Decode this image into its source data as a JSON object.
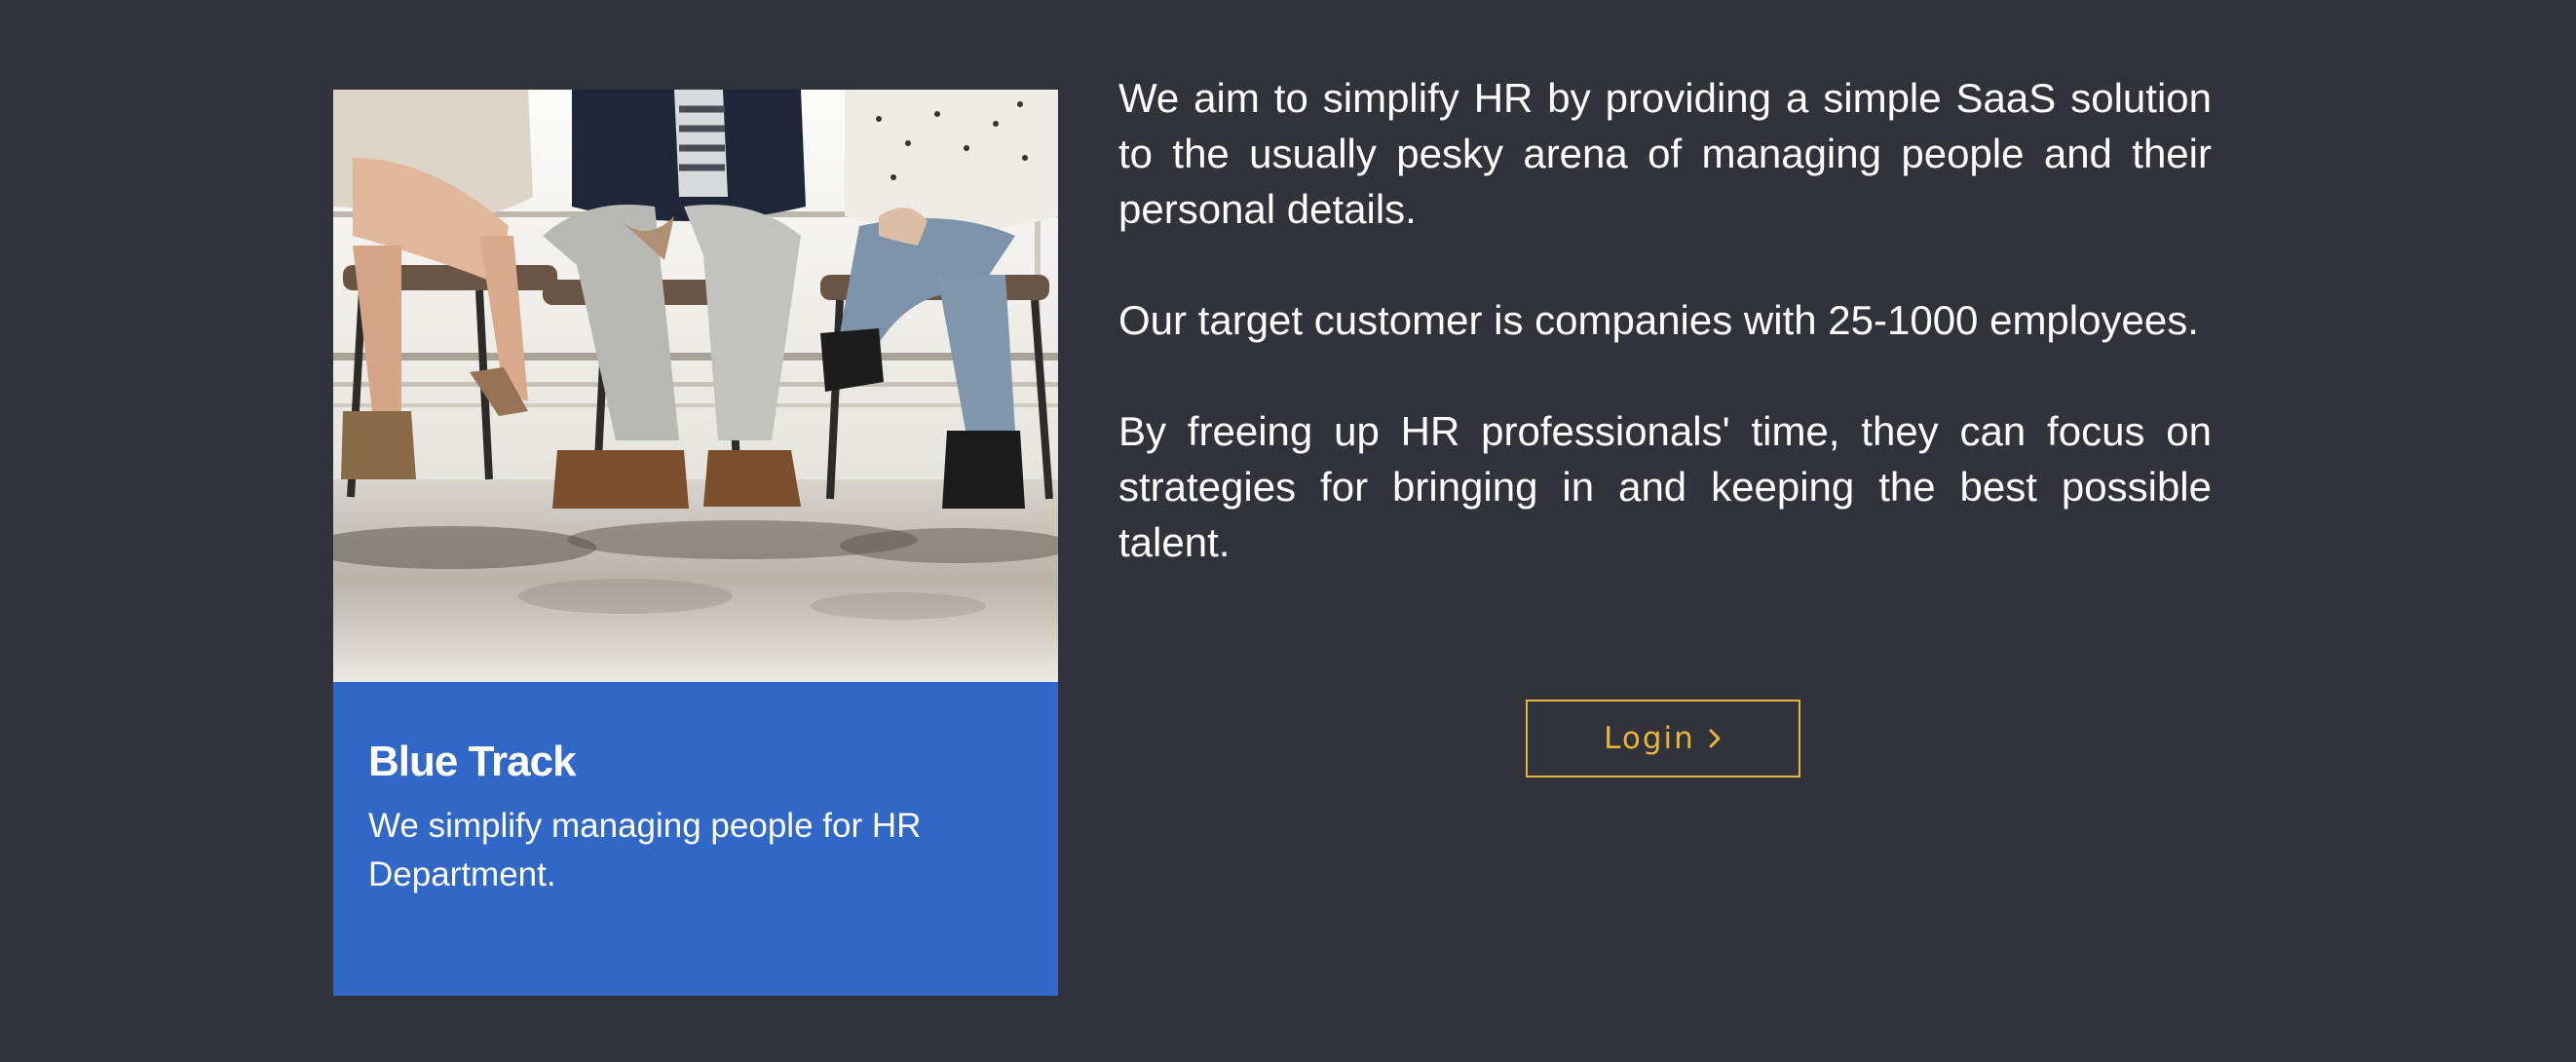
{
  "card": {
    "image": "people-sitting-on-chairs-photo",
    "title": "Blue Track",
    "subtitle": "We simplify managing people for HR Department."
  },
  "about": {
    "paragraphs": [
      "We aim to simplify HR by providing a simple SaaS solution to the usually pesky arena of managing people and their personal details.",
      "Our target customer is companies with 25-1000 employees.",
      "By freeing up HR professionals' time, they can focus on strategies for bringing in and keeping the best possible talent."
    ]
  },
  "login": {
    "label": "Login",
    "icon": "chevron-right-icon"
  },
  "colors": {
    "background": "#32323a",
    "card": "#3168c8",
    "accent": "#e8b53c",
    "text": "#ffffff"
  }
}
